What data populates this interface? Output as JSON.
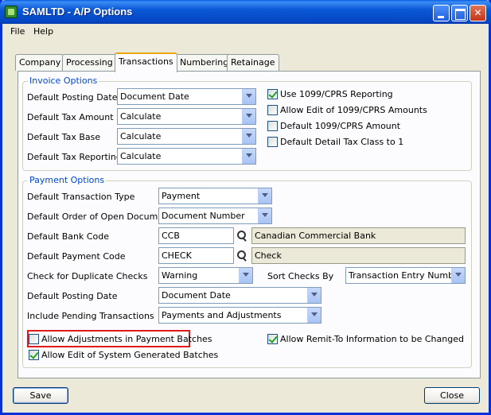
{
  "window": {
    "title": "SAMLTD - A/P Options",
    "minimize_icon": "minimize-icon",
    "maximize_icon": "maximize-icon",
    "close_glyph": "✕"
  },
  "menu": {
    "file": "File",
    "help": "Help"
  },
  "tabs": [
    {
      "label": "Company",
      "active": false
    },
    {
      "label": "Processing",
      "active": false
    },
    {
      "label": "Transactions",
      "active": true
    },
    {
      "label": "Numbering",
      "active": false
    },
    {
      "label": "Retainage",
      "active": false
    }
  ],
  "invoice_options": {
    "title": "Invoice Options",
    "posting_date": {
      "label": "Default Posting Date",
      "value": "Document Date"
    },
    "tax_amount": {
      "label": "Default Tax Amount",
      "value": "Calculate"
    },
    "tax_base": {
      "label": "Default Tax Base",
      "value": "Calculate"
    },
    "tax_reporting": {
      "label": "Default Tax Reporting",
      "value": "Calculate"
    },
    "use_1099": {
      "label": "Use 1099/CPRS Reporting",
      "checked": true
    },
    "allow_edit_1099": {
      "label": "Allow Edit of 1099/CPRS Amounts",
      "checked": false
    },
    "default_1099_amount": {
      "label": "Default 1099/CPRS Amount",
      "checked": false
    },
    "default_detail_tax": {
      "label": "Default Detail Tax Class to 1",
      "checked": false
    }
  },
  "payment_options": {
    "title": "Payment Options",
    "transaction_type": {
      "label": "Default Transaction Type",
      "value": "Payment"
    },
    "order_open_docs": {
      "label": "Default Order of Open Documents",
      "value": "Document Number"
    },
    "bank_code": {
      "label": "Default Bank Code",
      "value": "CCB",
      "description": "Canadian Commercial Bank"
    },
    "payment_code": {
      "label": "Default Payment Code",
      "value": "CHECK",
      "description": "Check"
    },
    "duplicate_checks": {
      "label": "Check for Duplicate Checks",
      "value": "Warning"
    },
    "sort_checks": {
      "label": "Sort Checks By",
      "value": "Transaction Entry Number"
    },
    "posting_date": {
      "label": "Default Posting Date",
      "value": "Document Date"
    },
    "pending_transactions": {
      "label": "Include Pending Transactions",
      "value": "Payments and Adjustments"
    },
    "allow_adjustments": {
      "label": "Allow Adjustments in Payment Batches",
      "checked": false
    },
    "allow_remit_to": {
      "label": "Allow Remit-To Information to be Changed",
      "checked": true
    },
    "allow_edit_generated": {
      "label": "Allow Edit of System Generated Batches",
      "checked": true
    }
  },
  "buttons": {
    "save": "Save",
    "close": "Close"
  },
  "colors": {
    "titlebar": "#0a58d6",
    "group_title": "#0046d5",
    "highlight": "#e01b1b"
  }
}
